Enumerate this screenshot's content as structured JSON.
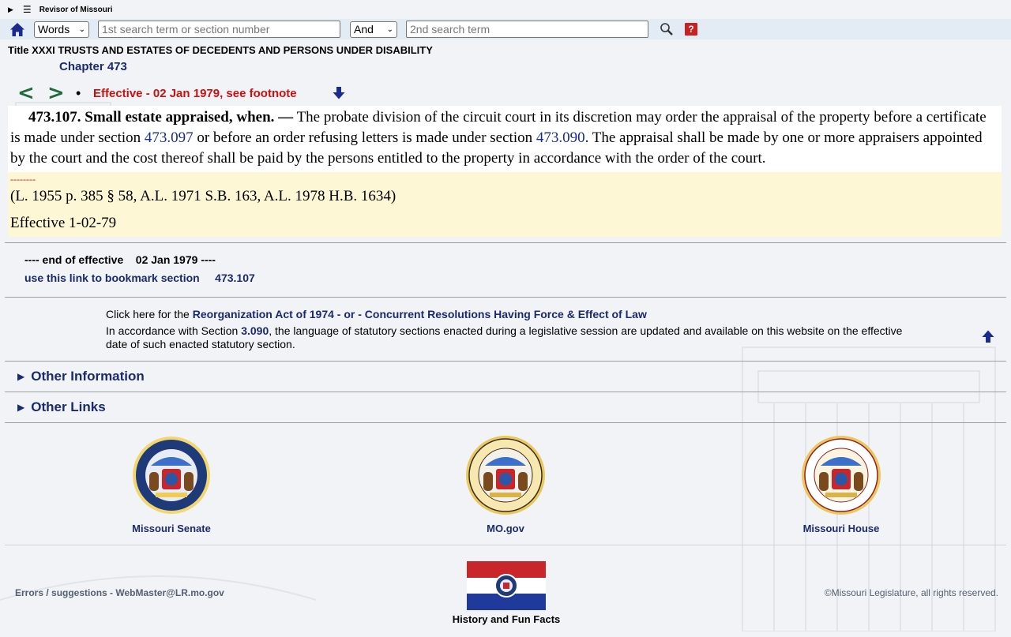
{
  "header": {
    "site_title": "Revisor of Missouri"
  },
  "search": {
    "mode_value": "Words",
    "term1_placeholder": "1st search term or section number",
    "operator_value": "And",
    "term2_placeholder": "2nd search term",
    "help_label": "?"
  },
  "breadcrumb": {
    "title": "Title XXXI TRUSTS AND ESTATES OF DECEDENTS AND PERSONS UNDER DISABILITY",
    "chapter": "Chapter 473"
  },
  "nav": {
    "prev": "<",
    "next": ">",
    "dot": "•",
    "effective": "Effective - 02 Jan 1979, see footnote"
  },
  "statute": {
    "heading": "473.107.  Small estate appraised, when. —",
    "text_1": " The probate division of the circuit court in its discretion may order the appraisal of the property before a certificate is made under section ",
    "link_1": "473.097",
    "text_2": " or before an order refusing letters is made under section ",
    "link_2": "473.090",
    "text_3": ".  The appraisal shall be made by one or more appraisers appointed by the court and the cost thereof shall be paid by the persons entitled to the property in accordance with the order of the court."
  },
  "footnote": {
    "dashes": "--------",
    "history": "(L. 1955 p. 385 § 58, A.L. 1971 S.B. 163, A.L. 1978 H.B. 1634)",
    "effective": "Effective 1-02-79"
  },
  "end_of_effective": {
    "prefix": "---- end of effective",
    "date": "02 Jan 1979",
    "suffix": "----",
    "bookmark_label": "use this link to bookmark section",
    "bookmark_section": "473.107"
  },
  "info": {
    "click_prefix": "Click here for the ",
    "reorg_link": "Reorganization Act of 1974",
    "sep": " - or - ",
    "concurrent_link": "Concurrent Resolutions Having Force & Effect of Law",
    "accord_prefix": "In accordance with Section ",
    "accord_link": "3.090",
    "accord_suffix": ", the language of statutory sections enacted during a legislative session are updated and available on this website on the effective date of such enacted statutory section."
  },
  "sections": {
    "other_information": "Other Information",
    "other_links": "Other Links"
  },
  "seals": {
    "senate": "Missouri Senate",
    "mogov": "MO.gov",
    "house": "Missouri House"
  },
  "footer": {
    "errors": "Errors / suggestions - WebMaster@LR.mo.gov",
    "flag_caption": "History and Fun Facts",
    "copyright": "©Missouri Legislature, all rights reserved."
  },
  "colors": {
    "link_blue": "#1a2b6d",
    "effective_red": "#cc1010",
    "nav_green": "#1f6b3a",
    "footnote_bg": "#fdf7d6",
    "search_bg": "#e3ebf5"
  }
}
